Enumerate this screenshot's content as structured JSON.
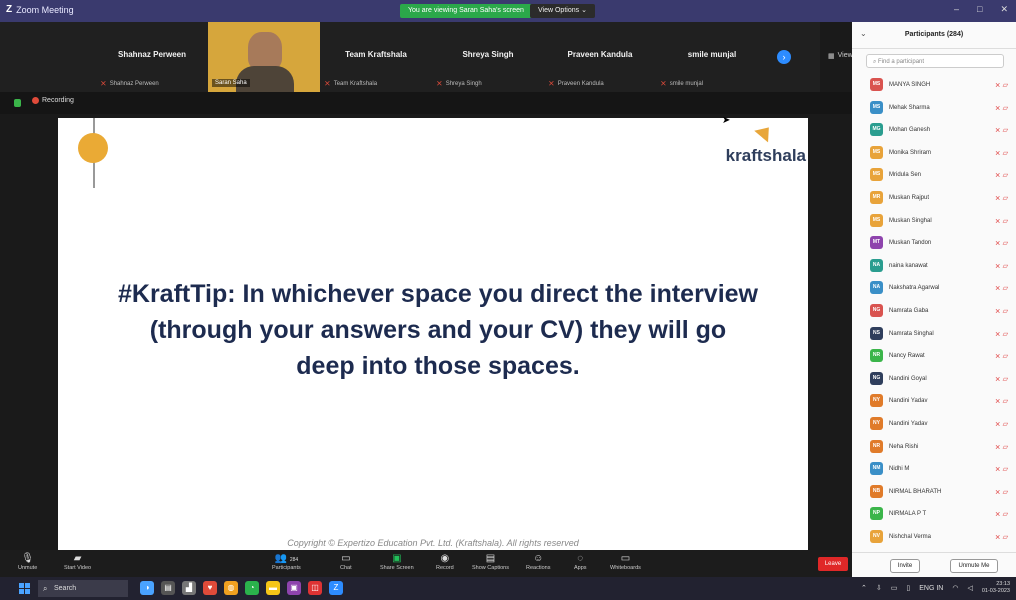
{
  "titlebar": {
    "app_title": "Zoom Meeting",
    "share_notice": "You are viewing Saran Saha's screen",
    "view_options": "View Options"
  },
  "strip": {
    "tiles": [
      {
        "name": "Shahnaz Perween",
        "sub": "Shahnaz Perween"
      },
      {
        "name": "",
        "sub": "Saran Saha"
      },
      {
        "name": "Team Kraftshala",
        "sub": "Team Kraftshala"
      },
      {
        "name": "Shreya Singh",
        "sub": "Shreya Singh"
      },
      {
        "name": "Praveen Kandula",
        "sub": "Praveen Kandula"
      },
      {
        "name": "smile munjal",
        "sub": "smile munjal"
      }
    ],
    "view_label": "View"
  },
  "recording": {
    "label": "Recording"
  },
  "slide": {
    "brand": "kraftshala",
    "tip": "#KraftTip: In whichever space you direct the interview (through your answers and your CV) they will go deep into those spaces.",
    "copyright": "Copyright © Expertizo Education Pvt. Ltd. (Kraftshala). All rights reserved"
  },
  "participants": {
    "title": "Participants (284)",
    "search_placeholder": "Find a participant",
    "list": [
      {
        "initials": "MS",
        "name": "MANYA SINGH",
        "color": "#d9534f"
      },
      {
        "initials": "MS",
        "name": "Mehak Sharma",
        "color": "#3a8fc7"
      },
      {
        "initials": "MG",
        "name": "Mohan Ganesh",
        "color": "#2a9d8f"
      },
      {
        "initials": "MS",
        "name": "Monika Shriram",
        "color": "#e8a33a"
      },
      {
        "initials": "MS",
        "name": "Mridula Sen",
        "color": "#e8a33a"
      },
      {
        "initials": "MR",
        "name": "Muskan Rajput",
        "color": "#e8a33a"
      },
      {
        "initials": "MS",
        "name": "Muskan Singhal",
        "color": "#e8a33a"
      },
      {
        "initials": "MT",
        "name": "Muskan Tandon",
        "color": "#8e44ad"
      },
      {
        "initials": "NA",
        "name": "naina kanawat",
        "color": "#2a9d8f"
      },
      {
        "initials": "NA",
        "name": "Nakshatra Agarwal",
        "color": "#3a8fc7"
      },
      {
        "initials": "NG",
        "name": "Namrata Gaba",
        "color": "#d9534f"
      },
      {
        "initials": "NS",
        "name": "Namrata Singhal",
        "color": "#2f3e5c"
      },
      {
        "initials": "NR",
        "name": "Nancy Rawat",
        "color": "#3bb54a"
      },
      {
        "initials": "NG",
        "name": "Nandini Goyal",
        "color": "#2f3e5c"
      },
      {
        "initials": "NY",
        "name": "Nandini Yadav",
        "color": "#e07b2a"
      },
      {
        "initials": "NY",
        "name": "Nandini Yadav",
        "color": "#e07b2a"
      },
      {
        "initials": "NR",
        "name": "Neha Rishi",
        "color": "#e07b2a"
      },
      {
        "initials": "NM",
        "name": "Nidhi M",
        "color": "#3a8fc7"
      },
      {
        "initials": "NB",
        "name": "NIRMAL BHARATH",
        "color": "#e07b2a"
      },
      {
        "initials": "NP",
        "name": "NIRMALA P T",
        "color": "#3bb54a"
      },
      {
        "initials": "NV",
        "name": "Nishchal Verma",
        "color": "#e8a33a"
      }
    ],
    "invite_label": "Invite",
    "unmute_label": "Unmute Me"
  },
  "toolbar": {
    "unmute": "Unmute",
    "start_video": "Start Video",
    "participants": "Participants",
    "participants_count": "284",
    "chat": "Chat",
    "share_screen": "Share Screen",
    "record": "Record",
    "captions": "Show Captions",
    "reactions": "Reactions",
    "apps": "Apps",
    "whiteboards": "Whiteboards",
    "leave": "Leave"
  },
  "taskbar": {
    "search_label": "Search",
    "lang": "ENG IN",
    "time": "23:13",
    "date": "01-03-2023"
  }
}
